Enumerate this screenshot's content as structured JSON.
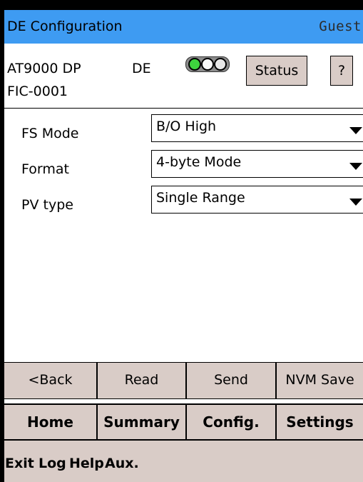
{
  "titlebar": {
    "title": "DE Configuration",
    "user": "Guest"
  },
  "device": {
    "model": "AT9000 DP",
    "mode": "DE",
    "tag": "FIC-0001",
    "status_label": "Status",
    "help_label": "?"
  },
  "indicator": {
    "icon": "traffic-light-icon",
    "lights": [
      "green",
      "off",
      "off"
    ]
  },
  "form": {
    "rows": [
      {
        "label": "FS Mode",
        "value": "B/O High"
      },
      {
        "label": "Format",
        "value": "4-byte Mode"
      },
      {
        "label": "PV type",
        "value": "Single Range"
      }
    ]
  },
  "actions": [
    "<Back",
    "Read",
    "Send",
    "NVM Save"
  ],
  "nav": [
    "Home",
    "Summary",
    "Config.",
    "Settings"
  ],
  "menu": [
    "Exit",
    "Log",
    "Help",
    "Aux."
  ],
  "colors": {
    "titlebar": "#3e9bf2",
    "button": "#d9ccc7",
    "led_on": "#3ed43e"
  }
}
